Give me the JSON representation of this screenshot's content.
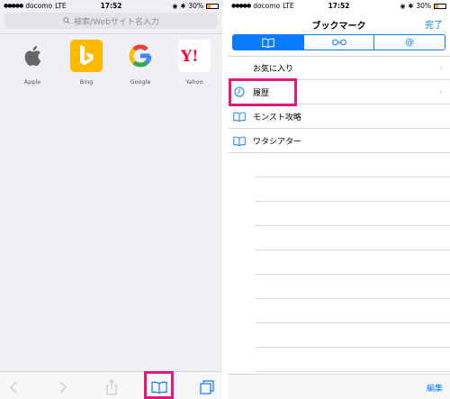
{
  "left": {
    "status": {
      "carrier": "docomo",
      "network": "LTE",
      "time": "17:52",
      "battery": "30%"
    },
    "address_bar": {
      "placeholder": "検索/Webサイト名入力"
    },
    "favorites": [
      {
        "label": "Apple",
        "icon": "apple-logo-icon"
      },
      {
        "label": "Bing",
        "icon": "bing-logo-icon"
      },
      {
        "label": "Google",
        "icon": "google-logo-icon"
      },
      {
        "label": "Yahoo",
        "icon": "yahoo-logo-icon"
      }
    ],
    "toolbar": [
      "back-icon",
      "forward-icon",
      "share-icon",
      "bookmarks-icon",
      "tabs-icon"
    ]
  },
  "right": {
    "status": {
      "carrier": "docomo",
      "network": "LTE",
      "time": "17:52",
      "battery": "30%"
    },
    "title": "ブックマーク",
    "done_label": "完了",
    "segments": [
      "bookmarks-icon",
      "reading-list-icon",
      "shared-links-icon"
    ],
    "rows": [
      {
        "label": "お気に入り",
        "icon": "",
        "chevron": true
      },
      {
        "label": "履歴",
        "icon": "history-clock-icon",
        "chevron": true
      },
      {
        "label": "モンスト攻略",
        "icon": "bookmark-book-icon",
        "chevron": false
      },
      {
        "label": "ワタシアター",
        "icon": "bookmark-book-icon",
        "chevron": false
      }
    ],
    "edit_label": "編集"
  },
  "colors": {
    "accent": "#0a7aff",
    "highlight": "#e5177d",
    "bing": "#fcb900",
    "yahoo": "#ff0033"
  }
}
